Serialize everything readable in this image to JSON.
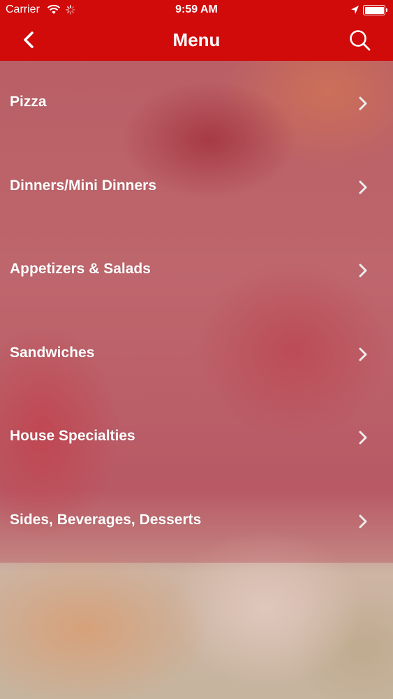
{
  "status_bar": {
    "carrier": "Carrier",
    "time": "9:59 AM"
  },
  "nav": {
    "title": "Menu",
    "back_icon": "chevron-left-icon",
    "search_icon": "search-icon"
  },
  "colors": {
    "brand_red": "#d10a0a",
    "text": "#ffffff"
  },
  "menu": {
    "items": [
      {
        "label": "Pizza"
      },
      {
        "label": "Dinners/Mini Dinners"
      },
      {
        "label": "Appetizers & Salads"
      },
      {
        "label": "Sandwiches"
      },
      {
        "label": "House Specialties"
      },
      {
        "label": "Sides, Beverages, Desserts"
      }
    ]
  }
}
